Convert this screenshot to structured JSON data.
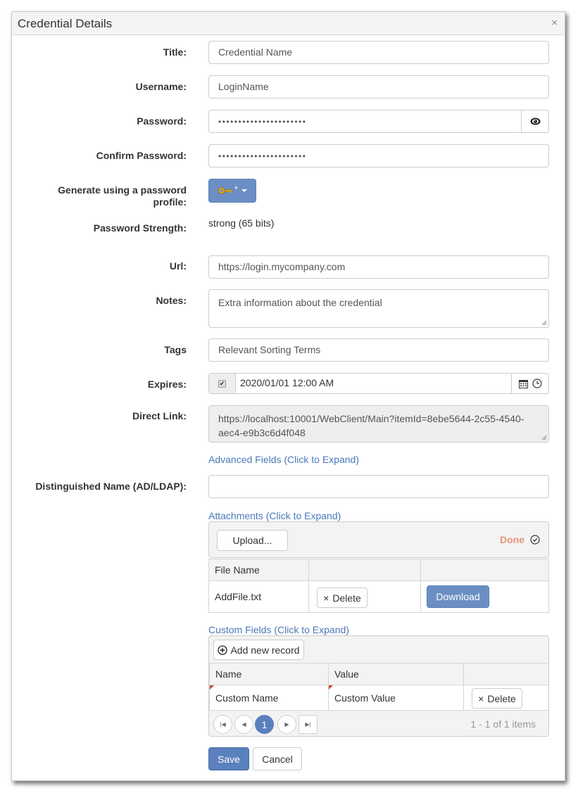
{
  "dialog": {
    "title": "Credential Details",
    "close_icon": "×"
  },
  "form": {
    "title_label": "Title:",
    "title_value": "Credential Name",
    "username_label": "Username:",
    "username_value": "LoginName",
    "password_label": "Password:",
    "password_value": "••••••••••••••••••••••",
    "confirm_label": "Confirm Password:",
    "confirm_value": "••••••••••••••••••••••",
    "generate_label_line1": "Generate using a password",
    "generate_label_line2": "profile:",
    "generate_button_star": "*",
    "strength_label": "Password Strength:",
    "strength_value": "strong (65 bits)",
    "url_label": "Url:",
    "url_value": "https://login.mycompany.com",
    "notes_label": "Notes:",
    "notes_value": "Extra information about the credential",
    "tags_label": "Tags",
    "tags_value": "Relevant Sorting Terms",
    "expires_label": "Expires:",
    "expires_checked": true,
    "expires_value": "2020/01/01 12:00 AM",
    "direct_link_label": "Direct Link:",
    "direct_link_value": "https://localhost:10001/WebClient/Main?itemId=8ebe5644-2c55-4540-aec4-e9b3c6d4f048",
    "advanced_link": "Advanced Fields (Click to Expand)",
    "dn_label": "Distinguished Name (AD/LDAP):",
    "dn_value": ""
  },
  "attachments": {
    "link": "Attachments (Click to Expand)",
    "upload_label": "Upload...",
    "status": "Done",
    "status_color": "#e8937a",
    "columns": [
      "File Name",
      "",
      ""
    ],
    "rows": [
      {
        "file_name": "AddFile.txt",
        "delete_label": "Delete",
        "download_label": "Download"
      }
    ]
  },
  "custom_fields": {
    "link": "Custom Fields (Click to Expand)",
    "add_label": "Add new record",
    "columns": [
      "Name",
      "Value",
      ""
    ],
    "rows": [
      {
        "name": "Custom Name",
        "value": "Custom Value",
        "delete_label": "Delete"
      }
    ],
    "pager": {
      "current_page": "1",
      "info": "1 - 1 of 1 items"
    }
  },
  "footer": {
    "save_label": "Save",
    "cancel_label": "Cancel"
  },
  "colors": {
    "accent": "#5a80bd",
    "link": "#4a78b8"
  }
}
